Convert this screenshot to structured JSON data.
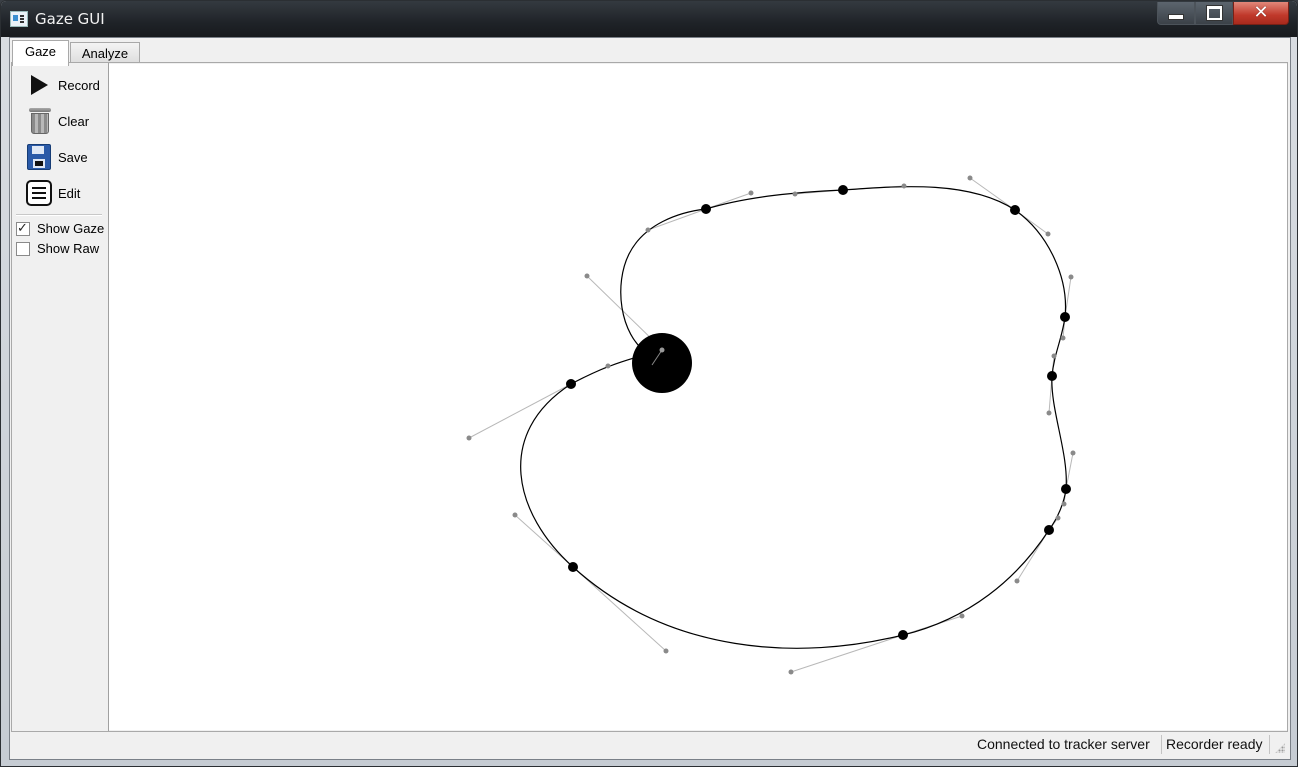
{
  "window": {
    "title": "Gaze GUI"
  },
  "tabs": [
    {
      "label": "Gaze",
      "active": true
    },
    {
      "label": "Analyze",
      "active": false
    }
  ],
  "toolbar": {
    "record_label": "Record",
    "clear_label": "Clear",
    "save_label": "Save",
    "edit_label": "Edit"
  },
  "options": {
    "show_gaze": {
      "label": "Show Gaze",
      "checked": true
    },
    "show_raw": {
      "label": "Show Raw",
      "checked": false
    }
  },
  "status": {
    "connection": "Connected to tracker server",
    "recorder": "Recorder ready"
  },
  "icons": [
    "play-icon",
    "trash-icon",
    "floppy-save-icon",
    "edit-list-icon",
    "window-icon",
    "minimize-icon",
    "maximize-icon",
    "close-icon",
    "size-grip-icon"
  ]
}
